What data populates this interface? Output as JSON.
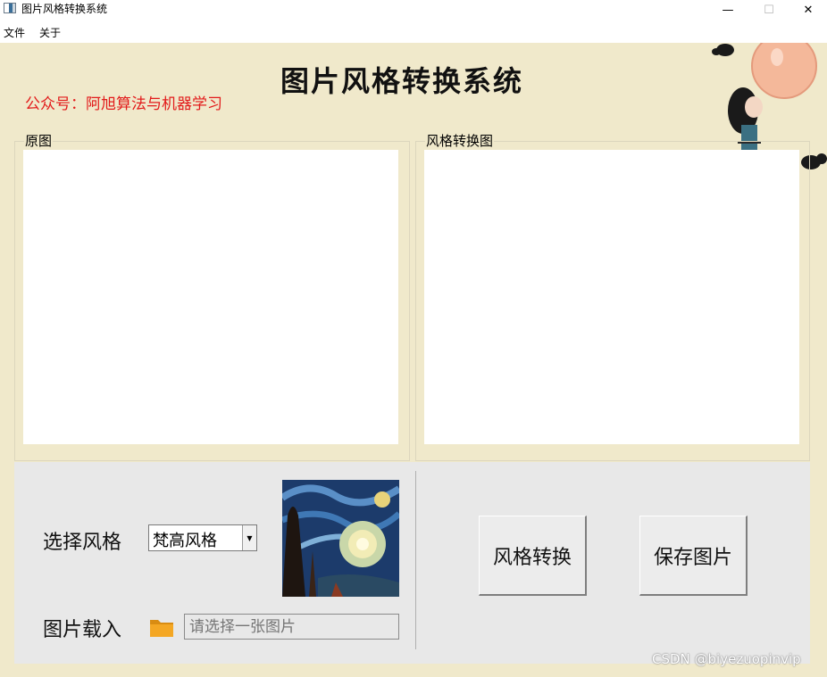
{
  "window": {
    "title": "图片风格转换系统",
    "minimize_glyph": "—",
    "maximize_glyph": "☐",
    "close_glyph": "✕"
  },
  "menu": {
    "items": [
      "文件",
      "关于"
    ]
  },
  "header": {
    "title": "图片风格转换系统",
    "subtitle": "公众号：阿旭算法与机器学习"
  },
  "panels": {
    "original_label": "原图",
    "converted_label": "风格转换图"
  },
  "controls": {
    "style_label": "选择风格",
    "style_selected": "梵高风格",
    "load_label": "图片载入",
    "path_placeholder": "请选择一张图片",
    "convert_button": "风格转换",
    "save_button": "保存图片"
  },
  "icons": {
    "folder": "folder-icon",
    "dropdown": "dropdown-arrow-icon"
  },
  "colors": {
    "background": "#f0e9cb",
    "subtitle": "#e21b1b",
    "panel": "#e8e8e8",
    "folder": "#f4a724"
  },
  "watermark": "CSDN @biyezuopinvip"
}
